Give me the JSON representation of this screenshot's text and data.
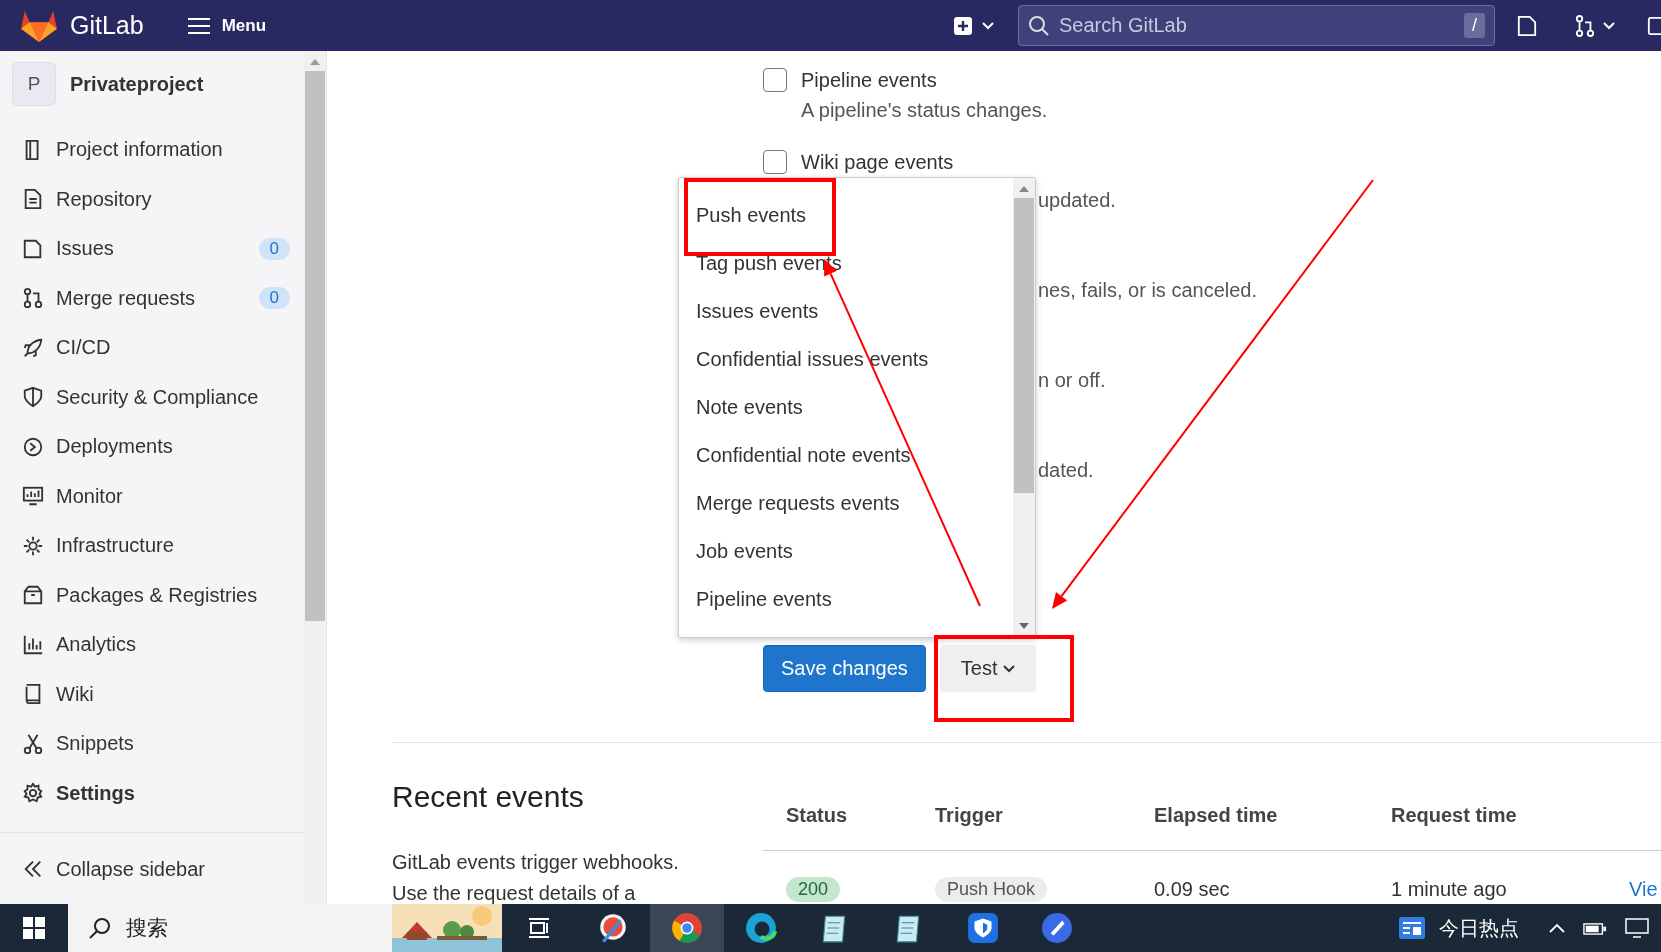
{
  "topbar": {
    "logo_text": "GitLab",
    "menu_label": "Menu",
    "search": {
      "placeholder": "Search GitLab"
    },
    "search_shortcut": "/"
  },
  "sidebar": {
    "project_initial": "P",
    "project_name": "Privateproject",
    "items": [
      {
        "label": "Project information",
        "selected": false
      },
      {
        "label": "Repository",
        "selected": false
      },
      {
        "label": "Issues",
        "badge": "0",
        "selected": false
      },
      {
        "label": "Merge requests",
        "badge": "0",
        "selected": false
      },
      {
        "label": "CI/CD",
        "selected": false
      },
      {
        "label": "Security & Compliance",
        "selected": false
      },
      {
        "label": "Deployments",
        "selected": false
      },
      {
        "label": "Monitor",
        "selected": false
      },
      {
        "label": "Infrastructure",
        "selected": false
      },
      {
        "label": "Packages & Registries",
        "selected": false
      },
      {
        "label": "Analytics",
        "selected": false
      },
      {
        "label": "Wiki",
        "selected": false
      },
      {
        "label": "Snippets",
        "selected": false
      },
      {
        "label": "Settings",
        "selected": true
      }
    ],
    "collapse_label": "Collapse sidebar"
  },
  "events": [
    {
      "label": "Pipeline events",
      "checked": false,
      "description": "A pipeline's status changes."
    },
    {
      "label": "Wiki page events",
      "checked": false
    }
  ],
  "description_fragments": [
    "updated.",
    "nes, fails, or is canceled.",
    "n or off.",
    "dated."
  ],
  "test_menu": {
    "items": [
      {
        "label": "Push events"
      },
      {
        "label": "Tag push events"
      },
      {
        "label": "Issues events"
      },
      {
        "label": "Confidential issues events"
      },
      {
        "label": "Note events"
      },
      {
        "label": "Confidential note events"
      },
      {
        "label": "Merge requests events"
      },
      {
        "label": "Job events"
      },
      {
        "label": "Pipeline events"
      }
    ]
  },
  "buttons": {
    "save": "Save changes",
    "test": "Test"
  },
  "recent_events": {
    "title": "Recent events",
    "description": "GitLab events trigger webhooks. Use the request details of a",
    "columns": [
      "Status",
      "Trigger",
      "Elapsed time",
      "Request time"
    ],
    "rows": [
      {
        "status": "200",
        "trigger": "Push Hook",
        "elapsed": "0.09 sec",
        "requested": "1 minute ago",
        "action": "Vie"
      }
    ]
  },
  "taskbar": {
    "search_label": "搜索",
    "news_label": "今日热点"
  }
}
